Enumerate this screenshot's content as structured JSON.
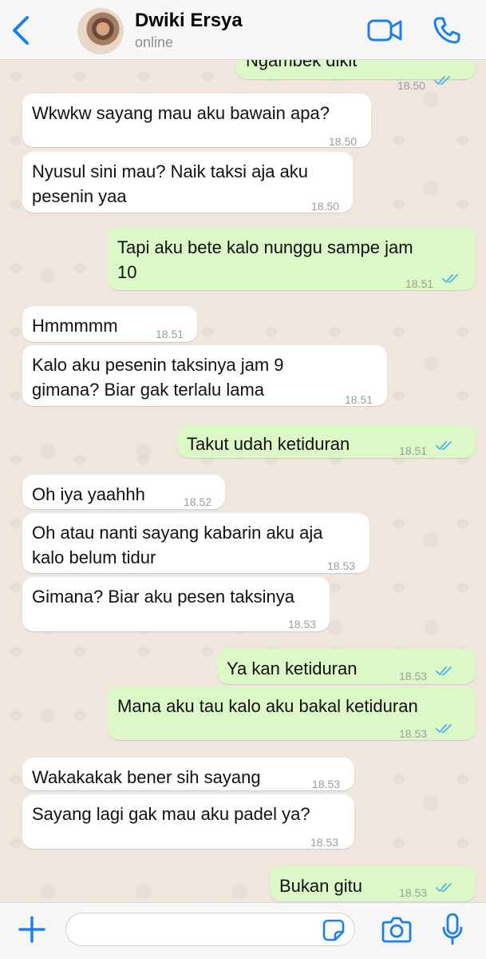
{
  "header": {
    "contact_name": "Dwiki Ersya",
    "status": "online"
  },
  "messages": [
    {
      "dir": "out",
      "text": "Ngambek dikit",
      "time": "18.50",
      "read": true
    },
    {
      "dir": "in",
      "text": "Wkwkw sayang mau aku bawain apa?",
      "time": "18.50"
    },
    {
      "dir": "in",
      "text": "Nyusul sini mau? Naik taksi aja aku\npesenin yaa",
      "time": "18.50"
    },
    {
      "dir": "out",
      "text": "Tapi aku bete kalo nunggu sampe jam\n10",
      "time": "18.51",
      "read": true
    },
    {
      "dir": "in",
      "text": "Hmmmmm",
      "time": "18.51"
    },
    {
      "dir": "in",
      "text": "Kalo aku pesenin taksinya jam 9\ngimana? Biar gak terlalu lama",
      "time": "18.51"
    },
    {
      "dir": "out",
      "text": "Takut udah ketiduran",
      "time": "18.51",
      "read": true
    },
    {
      "dir": "in",
      "text": "Oh iya yaahhh",
      "time": "18.52"
    },
    {
      "dir": "in",
      "text": "Oh atau nanti sayang kabarin aku aja\nkalo belum tidur",
      "time": "18.53"
    },
    {
      "dir": "in",
      "text": "Gimana? Biar aku pesen taksinya",
      "time": "18.53"
    },
    {
      "dir": "out",
      "text": "Ya kan ketiduran",
      "time": "18.53",
      "read": true
    },
    {
      "dir": "out",
      "text": "Mana aku tau kalo aku bakal ketiduran",
      "time": "18.53",
      "read": true
    },
    {
      "dir": "in",
      "text": "Wakakakak bener sih sayang",
      "time": "18.53"
    },
    {
      "dir": "in",
      "text": "Sayang lagi gak mau aku padel ya?",
      "time": "18.53"
    },
    {
      "dir": "out",
      "text": "Bukan gitu",
      "time": "18.53",
      "read": true
    }
  ],
  "composer": {
    "value": ""
  },
  "colors": {
    "accent": "#1a7ff5",
    "outgoing_bubble": "#dcf8c6",
    "incoming_bubble": "#ffffff",
    "read_check": "#4fb6ec"
  }
}
